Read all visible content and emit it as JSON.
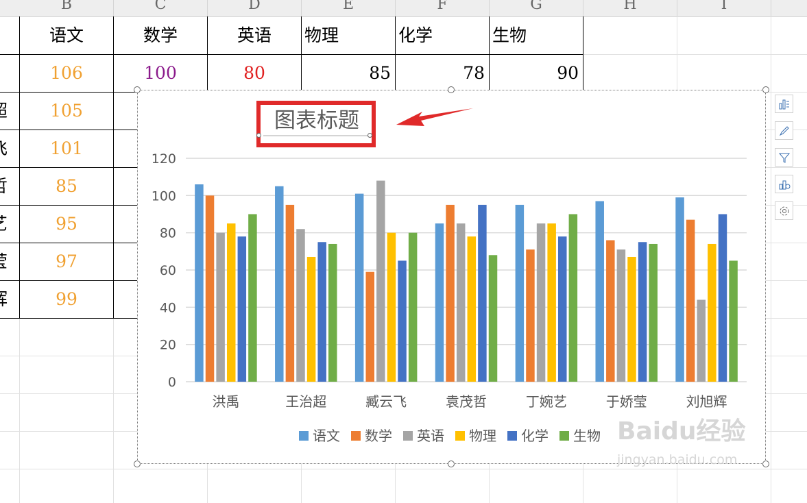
{
  "spreadsheet": {
    "columns": [
      {
        "letter": "B"
      },
      {
        "letter": "C"
      },
      {
        "letter": "D"
      },
      {
        "letter": "E"
      },
      {
        "letter": "F"
      },
      {
        "letter": "G"
      },
      {
        "letter": "H"
      },
      {
        "letter": "I"
      }
    ],
    "header_row": [
      "语文",
      "数学",
      "英语",
      "物理",
      "化学",
      "生物"
    ],
    "first_data_row": [
      "106",
      "100",
      "80",
      "85",
      "78",
      "90"
    ],
    "b_column_values": [
      "105",
      "101",
      "85",
      "95",
      "97",
      "99"
    ],
    "a_column_partial": [
      "超",
      "飞",
      "哲",
      "艺",
      "莹",
      "辉"
    ],
    "colors": {
      "yuwen": "#f0a030",
      "shuxue": "#8b1a8b",
      "yingyu": "#e02020",
      "default": "#000000"
    }
  },
  "chart_tools": [
    {
      "icon": "chart-elements-icon"
    },
    {
      "icon": "chart-styles-icon"
    },
    {
      "icon": "chart-filter-icon"
    },
    {
      "icon": "quick-layout-icon"
    },
    {
      "icon": "chart-settings-icon"
    }
  ],
  "chart_data": {
    "type": "bar",
    "title": "图表标题",
    "categories": [
      "洪禹",
      "王治超",
      "臧云飞",
      "袁茂哲",
      "丁婉艺",
      "于娇莹",
      "刘旭辉"
    ],
    "series": [
      {
        "name": "语文",
        "color": "#5b9bd5",
        "values": [
          106,
          105,
          101,
          85,
          95,
          97,
          99
        ]
      },
      {
        "name": "数学",
        "color": "#ed7d31",
        "values": [
          100,
          95,
          59,
          95,
          71,
          76,
          87
        ]
      },
      {
        "name": "英语",
        "color": "#a5a5a5",
        "values": [
          80,
          82,
          108,
          85,
          85,
          71,
          44
        ]
      },
      {
        "name": "物理",
        "color": "#ffc000",
        "values": [
          85,
          67,
          80,
          78,
          85,
          67,
          74
        ]
      },
      {
        "name": "化学",
        "color": "#4472c4",
        "values": [
          78,
          75,
          65,
          95,
          78,
          75,
          90
        ]
      },
      {
        "name": "生物",
        "color": "#70ad47",
        "values": [
          90,
          74,
          80,
          68,
          90,
          74,
          65
        ]
      }
    ],
    "yticks": [
      "0",
      "20",
      "40",
      "60",
      "80",
      "100",
      "120"
    ],
    "ylim": [
      0,
      120
    ],
    "grid": true,
    "legend_position": "bottom"
  },
  "annotation": {
    "highlight_color": "#e02a2a"
  },
  "watermark": {
    "brand": "Baidu经验",
    "url": "jingyan.baidu.com"
  }
}
